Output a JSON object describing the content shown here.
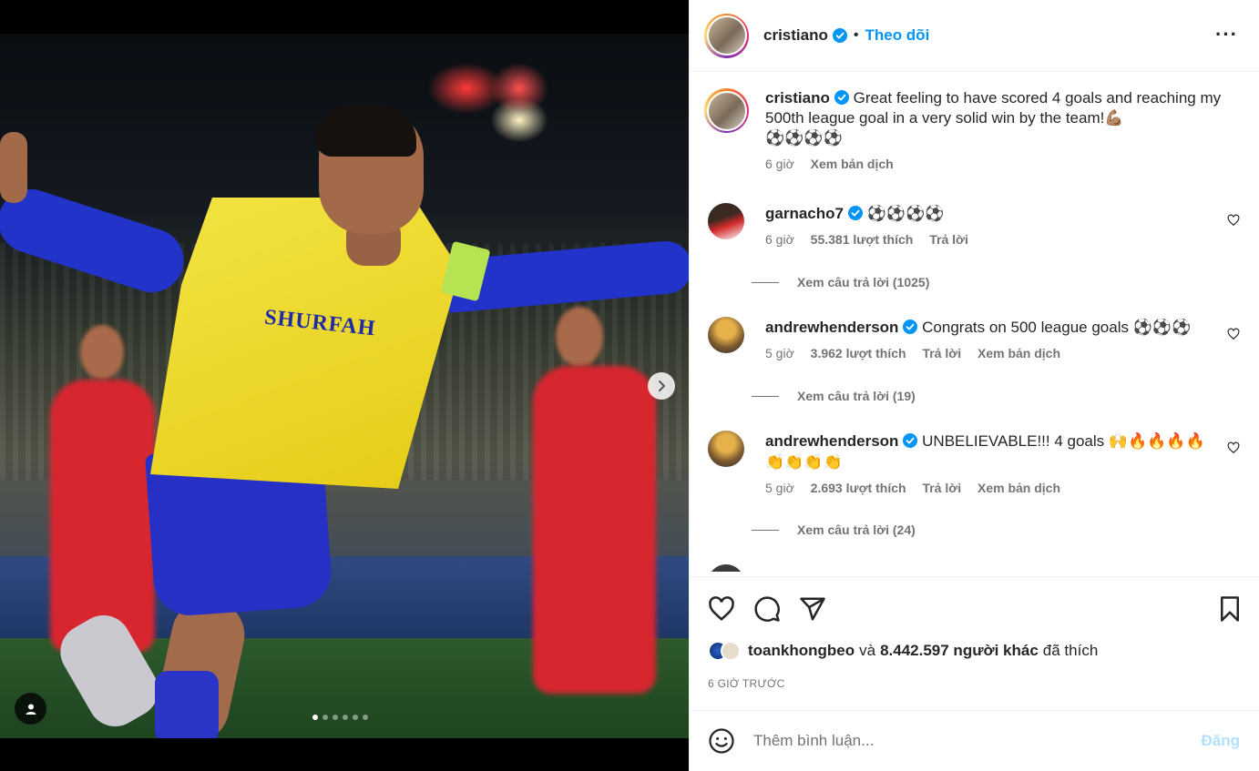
{
  "post": {
    "author": "cristiano",
    "follow_label": "Theo dõi",
    "separator": "•",
    "more_label": "···",
    "sponsor_text": "SHURFAH",
    "carousel": {
      "dot_count": 6,
      "active_index": 0
    }
  },
  "caption": {
    "username": "cristiano",
    "text": "Great feeling to have scored 4 goals and reaching my 500th league goal in a very solid win by the team!💪🏽",
    "emojis": "⚽⚽⚽⚽",
    "time": "6 giờ",
    "translate": "Xem bản dịch"
  },
  "comments": [
    {
      "username": "garnacho7",
      "text": "⚽⚽⚽⚽",
      "time": "6 giờ",
      "likes": "55.381 lượt thích",
      "reply": "Trả lời",
      "translate": "",
      "view_replies": "Xem câu trả lời (1025)"
    },
    {
      "username": "andrewhenderson",
      "text": "Congrats on 500 league goals ⚽⚽⚽",
      "time": "5 giờ",
      "likes": "3.962 lượt thích",
      "reply": "Trả lời",
      "translate": "Xem bản dịch",
      "view_replies": "Xem câu trả lời (19)"
    },
    {
      "username": "andrewhenderson",
      "text": "UNBELIEVABLE!!! 4 goals 🙌🔥🔥🔥🔥👏👏👏👏",
      "time": "5 giờ",
      "likes": "2.693 lượt thích",
      "reply": "Trả lời",
      "translate": "Xem bản dịch",
      "view_replies": "Xem câu trả lời (24)"
    }
  ],
  "likes_summary": {
    "first_user": "toankhongbeo",
    "connector": "và",
    "others": "8.442.597 người khác",
    "suffix": "đã thích"
  },
  "timestamp": "6 GIỜ TRƯỚC",
  "add_comment": {
    "placeholder": "Thêm bình luận...",
    "post_label": "Đăng"
  },
  "colors": {
    "accent": "#0095f6",
    "post_disabled": "#b2dffc",
    "text": "#262626",
    "muted": "#737373"
  },
  "icons": [
    "heart-icon",
    "comment-icon",
    "share-icon",
    "bookmark-icon",
    "emoji-icon",
    "verified-icon",
    "next-arrow-icon",
    "user-tag-icon",
    "more-options-icon"
  ]
}
